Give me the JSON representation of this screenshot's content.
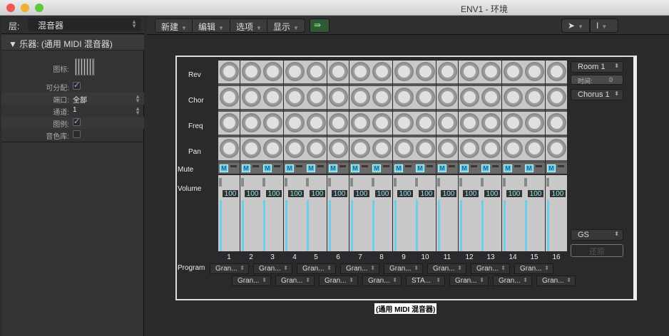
{
  "window": {
    "title": "ENV1 - 环境",
    "colors": {
      "close": "#ee5a52",
      "min": "#f0b030",
      "max": "#5cc83a"
    }
  },
  "left": {
    "layer_label": "层:",
    "layer_value": "混音器",
    "instrument_header": "▼ 乐器:  (通用 MIDI 混音器)",
    "props": [
      {
        "key": "图标:"
      },
      {
        "key": "可分配:",
        "checked": true
      },
      {
        "key": "端口:",
        "value": "全部"
      },
      {
        "key": "通道:",
        "value": "1"
      },
      {
        "key": "图例:",
        "checked": true
      },
      {
        "key": "音色库:",
        "checked": false
      }
    ]
  },
  "toolbar": {
    "menus": [
      "新建",
      "编辑",
      "选项",
      "显示"
    ],
    "link_icon": "midi-link-icon",
    "pointer_tool": "pointer-icon",
    "text_tool": "text-cursor-icon"
  },
  "mixer": {
    "row_labels": {
      "rev": "Rev",
      "chor": "Chor",
      "freq": "Freq",
      "pan": "Pan",
      "mute": "Mute",
      "volume": "Volume",
      "program": "Program"
    },
    "mute_label": "M",
    "channels": [
      {
        "n": "1",
        "vol": "100",
        "prog": "Gran..."
      },
      {
        "n": "2",
        "vol": "100",
        "prog": "Gran..."
      },
      {
        "n": "3",
        "vol": "100",
        "prog": "Gran..."
      },
      {
        "n": "4",
        "vol": "100",
        "prog": "Gran..."
      },
      {
        "n": "5",
        "vol": "100",
        "prog": "Gran..."
      },
      {
        "n": "6",
        "vol": "100",
        "prog": "Gran..."
      },
      {
        "n": "7",
        "vol": "100",
        "prog": "Gran..."
      },
      {
        "n": "8",
        "vol": "100",
        "prog": "Gran..."
      },
      {
        "n": "9",
        "vol": "100",
        "prog": "Gran..."
      },
      {
        "n": "10",
        "vol": "100",
        "prog": "STA..."
      },
      {
        "n": "11",
        "vol": "100",
        "prog": "Gran..."
      },
      {
        "n": "12",
        "vol": "100",
        "prog": "Gran..."
      },
      {
        "n": "13",
        "vol": "100",
        "prog": "Gran..."
      },
      {
        "n": "14",
        "vol": "100",
        "prog": "Gran..."
      },
      {
        "n": "15",
        "vol": "100",
        "prog": "Gran..."
      },
      {
        "n": "16",
        "vol": "100",
        "prog": "Gran..."
      }
    ],
    "reverb_type": "Room 1",
    "time_label": "时间:",
    "time_value": "0",
    "chorus_type": "Chorus 1",
    "mode": "GS",
    "reset": "还原",
    "caption": "(通用 MIDI 混音器)"
  }
}
